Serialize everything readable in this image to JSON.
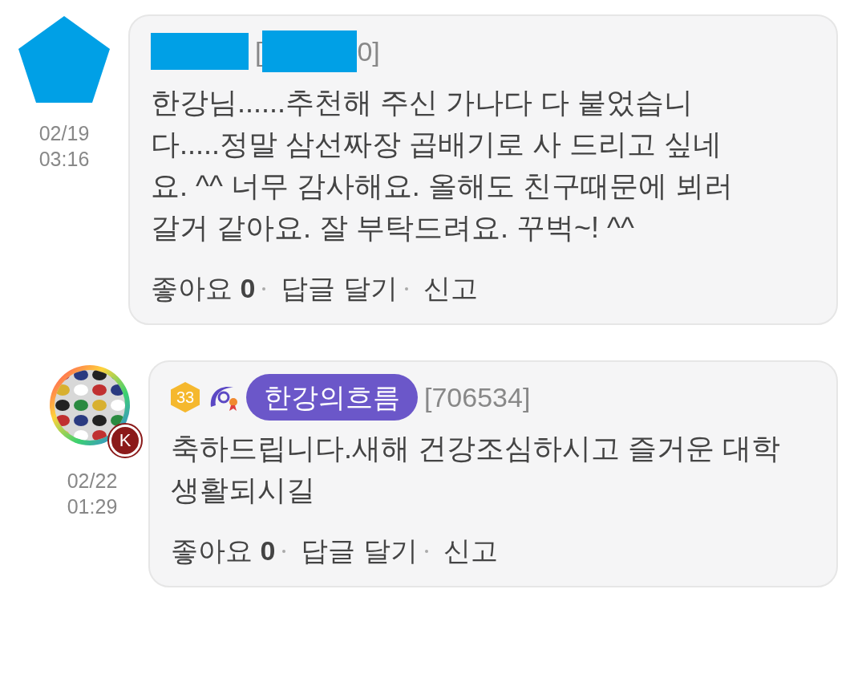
{
  "comments": [
    {
      "avatar": {
        "kind": "redacted"
      },
      "date": "02/19",
      "time": "03:16",
      "redacted": true,
      "user_id_fragments": [
        "[",
        "0]"
      ],
      "body": "한강님......추천해 주신 가나다 다 붙었습니다.....정말 삼선짜장 곱배기로 사 드리고 싶네요. ^^ 너무 감사해요. 올해도 친구때문에 뵈러 갈거 같아요. 잘 부탁드려요. 꾸벅~! ^^",
      "like_label": "좋아요",
      "like_count": "0",
      "reply": "답글 달기",
      "report": "신고"
    },
    {
      "avatar_badge": "K",
      "date": "02/22",
      "time": "01:29",
      "redacted": false,
      "level": "33",
      "nickname": "한강의흐름",
      "user_id": "[706534]",
      "body": "축하드립니다.새해 건강조심하시고 즐거운 대학생활되시길",
      "like_label": "좋아요",
      "like_count": "0",
      "reply": "답글 달기",
      "report": "신고"
    }
  ]
}
